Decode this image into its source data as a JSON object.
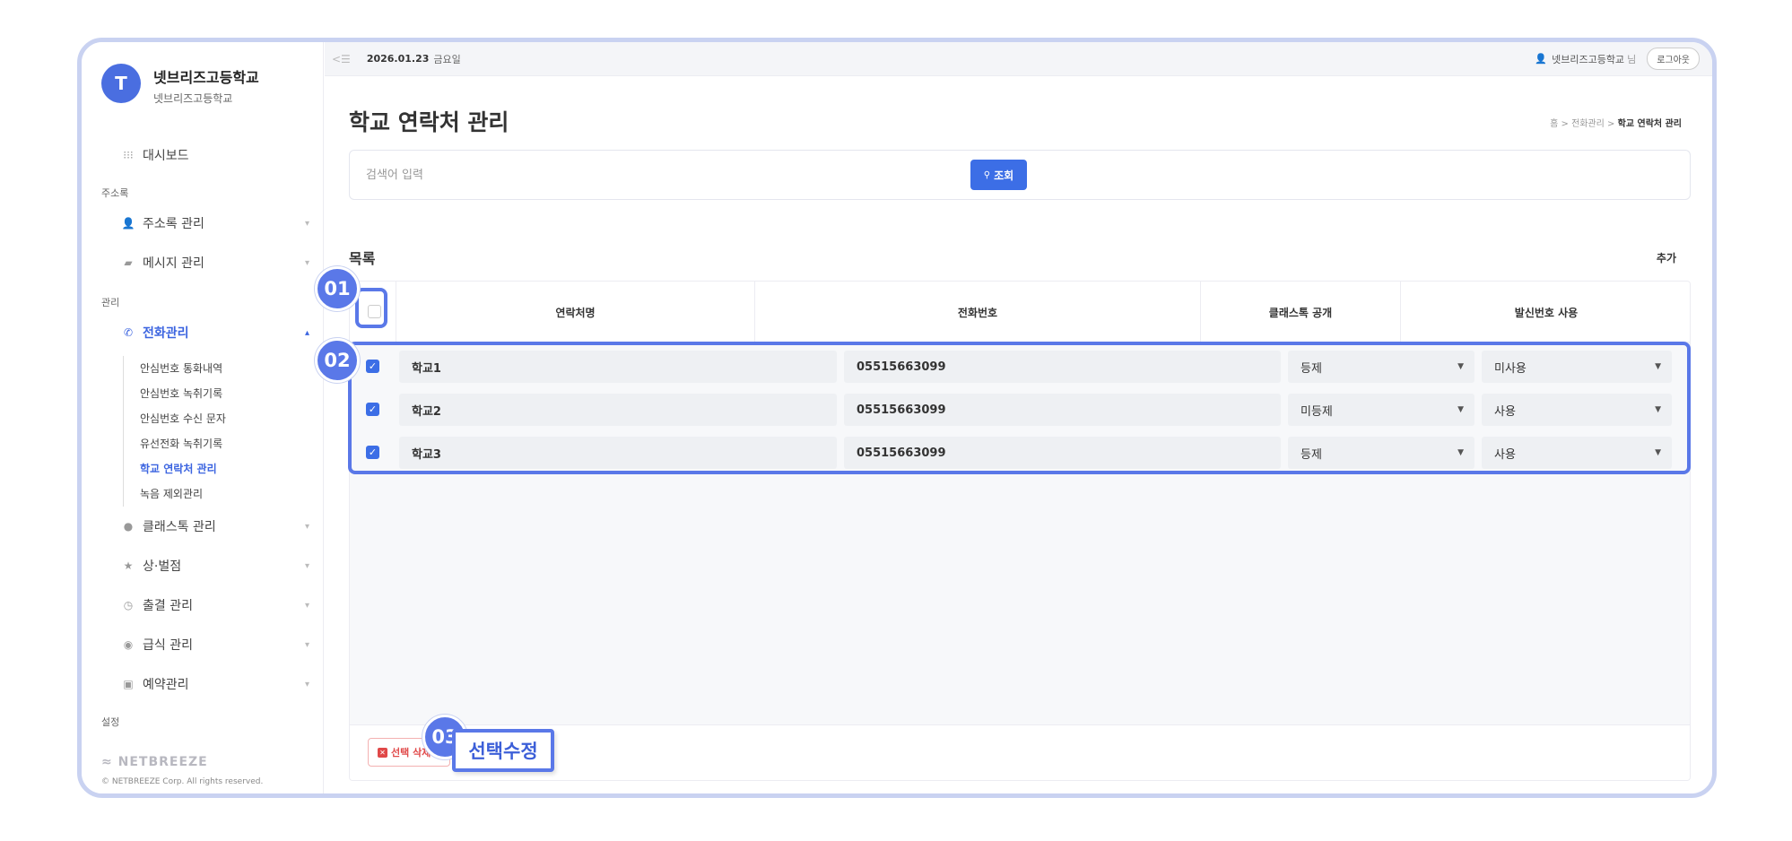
{
  "sidebar": {
    "avatar_letter": "T",
    "school_name": "넷브리즈고등학교",
    "school_sub": "넷브리즈고등학교",
    "dashboard": "대시보드",
    "section_addressbook": "주소록",
    "addressbook_manage": "주소록 관리",
    "message_manage": "메시지 관리",
    "section_manage": "관리",
    "phone_manage": "전화관리",
    "sub_items": [
      "안심번호 통화내역",
      "안심번호 녹취기록",
      "안심번호 수신 문자",
      "유선전화 녹취기록",
      "학교 연락처 관리",
      "녹음 제외관리"
    ],
    "classtalk_manage": "클래스톡 관리",
    "reward_penalty": "상·벌점",
    "attendance_manage": "출결 관리",
    "meal_manage": "급식 관리",
    "reservation_manage": "예약관리",
    "section_settings": "설정",
    "footer_logo": "NETBREEZE",
    "footer_copy": "© NETBREEZE Corp. All rights reserved."
  },
  "topbar": {
    "date": "2026.01.23",
    "day": "금요일",
    "user": "넷브리즈고등학교",
    "user_suffix": "님",
    "logout": "로그아웃"
  },
  "page": {
    "title": "학교 연락처 관리",
    "breadcrumb_home": "홈",
    "breadcrumb_mid": "전화관리",
    "breadcrumb_current": "학교 연락처 관리",
    "search_placeholder": "검색어 입력",
    "search_button": "조회",
    "list_title": "목록",
    "add_link": "추가"
  },
  "table": {
    "headers": [
      "연락처명",
      "전화번호",
      "클래스톡 공개",
      "발신번호 사용"
    ],
    "rows": [
      {
        "name": "학교1",
        "phone": "05515663099",
        "classtalk": "등제",
        "caller": "미사용",
        "checked": true
      },
      {
        "name": "학교2",
        "phone": "05515663099",
        "classtalk": "미등제",
        "caller": "사용",
        "checked": true
      },
      {
        "name": "학교3",
        "phone": "05515663099",
        "classtalk": "등제",
        "caller": "사용",
        "checked": true
      }
    ]
  },
  "footer": {
    "delete_button": "선택 삭제",
    "edit_button": "선택수정"
  },
  "annotations": [
    "01",
    "02",
    "03"
  ],
  "colors": {
    "accent": "#3c6ee6",
    "annotation": "#5a78e8",
    "frame": "#c9d2f1",
    "danger": "#e04848"
  }
}
